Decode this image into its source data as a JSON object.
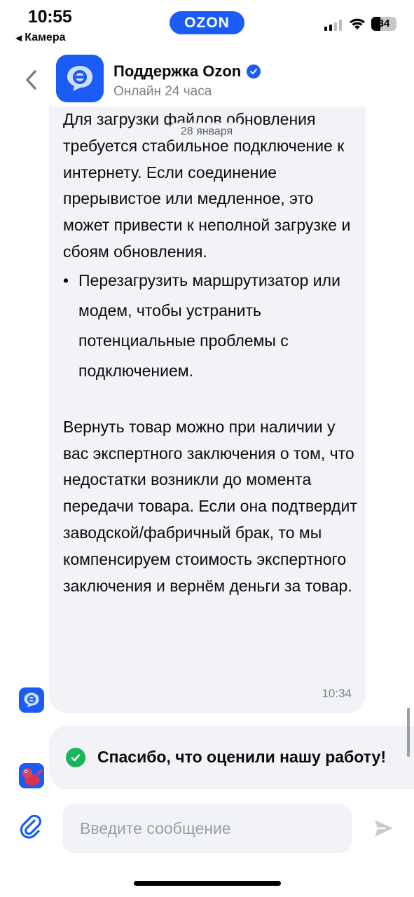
{
  "status_bar": {
    "time": "10:55",
    "back_app": "Камера",
    "brand_badge": "OZON",
    "battery_level": "34"
  },
  "header": {
    "title": "Поддержка Ozon",
    "subtitle": "Онлайн 24 часа"
  },
  "date_chip": "28 января",
  "message": {
    "paragraph1": "Для загрузки файлов обновления требуется стабильное подключение к интернету. Если соединение прерывистое или медленное, это может привести к неполной загрузке и сбоям обновления.",
    "bullet_mark": "•",
    "bullet": "Перезагрузить маршрутизатор или модем, чтобы устранить потенциальные проблемы с подключением.",
    "paragraph2": "Вернуть товар можно при наличии у вас экспертного заключения о том, что недостатки возникли до момента передачи товара. Если она подтвердит заводской/фабричный брак, то мы компенсируем стоимость экспертного заключения и вернём деньги за товар.",
    "time": "10:34"
  },
  "rating": {
    "text": "Спасибо, что оценили нашу работу!"
  },
  "composer": {
    "placeholder": "Введите сообщение"
  },
  "colors": {
    "accent": "#1a5cf5",
    "bubble": "#f2f3f7",
    "success": "#19b55a",
    "secondary_text": "#7b8089"
  }
}
